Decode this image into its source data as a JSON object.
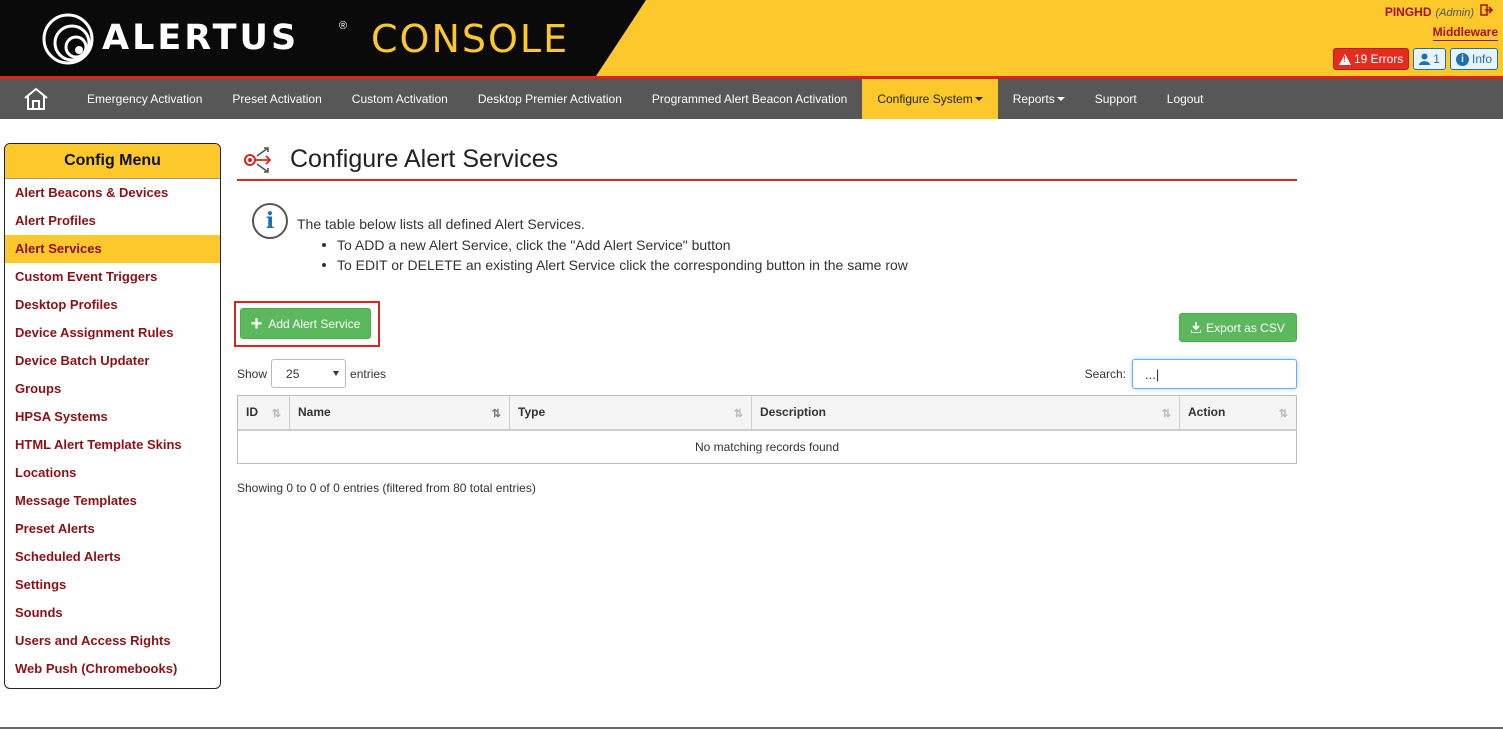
{
  "header": {
    "logo_text": "ALERTUS",
    "logo_reg": "®",
    "logo_console": "CONSOLE",
    "username": "PINGHD",
    "user_role": "(Admin)",
    "middleware": "Middleware",
    "errors_label": "19 Errors",
    "users_count": "1",
    "info_label": "Info"
  },
  "nav": {
    "items": [
      "Emergency Activation",
      "Preset Activation",
      "Custom Activation",
      "Desktop Premier Activation",
      "Programmed Alert Beacon Activation",
      "Configure System",
      "Reports",
      "Support",
      "Logout"
    ],
    "active": "Configure System"
  },
  "sidebar": {
    "title": "Config Menu",
    "items": [
      "Alert Beacons & Devices",
      "Alert Profiles",
      "Alert Services",
      "Custom Event Triggers",
      "Desktop Profiles",
      "Device Assignment Rules",
      "Device Batch Updater",
      "Groups",
      "HPSA Systems",
      "HTML Alert Template Skins",
      "Locations",
      "Message Templates",
      "Preset Alerts",
      "Scheduled Alerts",
      "Settings",
      "Sounds",
      "Users and Access Rights",
      "Web Push (Chromebooks)"
    ],
    "active": "Alert Services"
  },
  "main": {
    "title": "Configure Alert Services",
    "info_line": "The table below lists all defined Alert Services.",
    "bullets": [
      "To ADD a new Alert Service, click the \"Add Alert Service\" button",
      "To EDIT or DELETE an existing Alert Service click the corresponding button in the same row"
    ],
    "add_button": "Add Alert Service",
    "export_button": "Export as CSV",
    "show_label": "Show",
    "entries_value": "25",
    "entries_label": "entries",
    "search_label": "Search:",
    "search_value": "...|",
    "columns": [
      "ID",
      "Name",
      "Type",
      "Description",
      "Action"
    ],
    "empty_message": "No matching records found",
    "footer": "Showing 0 to 0 of 0 entries (filtered from 80 total entries)"
  },
  "colors": {
    "brand_yellow": "#fcc82b",
    "brand_red": "#d9261c",
    "nav_gray": "#575757",
    "link_dark_red": "#8b1116",
    "button_green": "#5cb85c"
  }
}
